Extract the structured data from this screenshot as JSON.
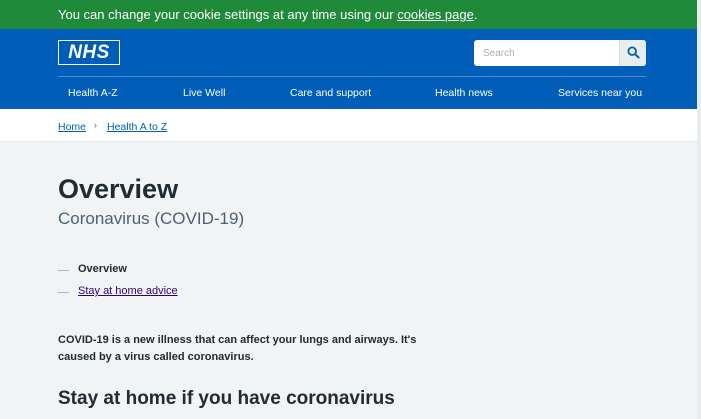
{
  "cookie_banner": {
    "text": "You can change your cookie settings at any time using our ",
    "link": "cookies page",
    "suffix": "."
  },
  "header": {
    "logo": "NHS",
    "search": {
      "placeholder": "Search",
      "icon": "search-icon"
    },
    "nav": [
      "Health A-Z",
      "Live Well",
      "Care and support",
      "Health news",
      "Services near you"
    ]
  },
  "breadcrumb": [
    "Home",
    "Health A to Z"
  ],
  "page": {
    "title": "Overview",
    "subtitle": "Coronavirus (COVID-19)",
    "contents": [
      {
        "label": "Overview",
        "current": true
      },
      {
        "label": "Stay at home advice",
        "current": false
      }
    ],
    "intro_line1": "COVID-19 is a new illness that can affect your lungs and airways. It's",
    "intro_line2": "caused by a virus called coronavirus.",
    "section_heading": "Stay at home if you have coronavirus"
  },
  "colors": {
    "cookie_green": "#1f8a3a",
    "nhs_blue": "#005eb8",
    "link_blue": "#005eb8",
    "visited_purple": "#330072",
    "page_bg": "#f0f4f5"
  }
}
